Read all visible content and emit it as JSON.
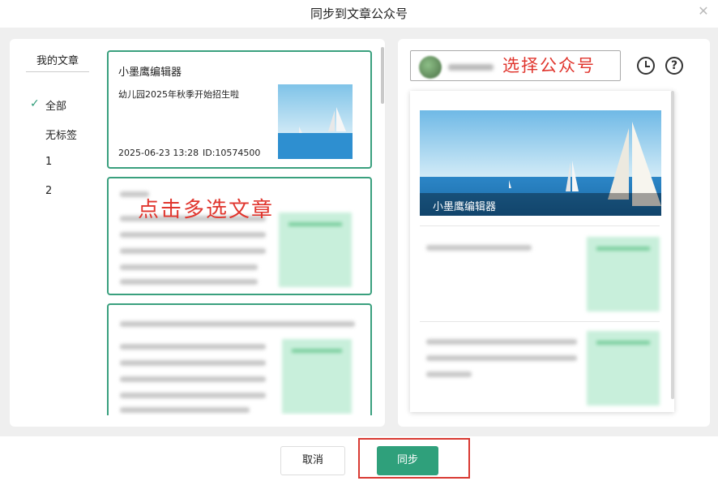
{
  "dialog": {
    "title": "同步到文章公众号"
  },
  "sidebar": {
    "title": "我的文章",
    "items": [
      {
        "label": "全部",
        "selected": true
      },
      {
        "label": "无标签"
      },
      {
        "label": "1"
      },
      {
        "label": "2"
      }
    ]
  },
  "articles": [
    {
      "account": "小墨鹰编辑器",
      "title": "幼儿园2025年秋季开始招生啦",
      "date": "2025-06-23 13:28",
      "id": "ID:10574500"
    }
  ],
  "annotations": {
    "multi_select": "点击多选文章",
    "choose_account": "选择公众号"
  },
  "preview": {
    "cover_caption": "小墨鹰编辑器"
  },
  "footer": {
    "cancel_label": "取消",
    "sync_label": "同步"
  },
  "colors": {
    "accent": "#2fa07b",
    "annotation": "#e0362e"
  }
}
